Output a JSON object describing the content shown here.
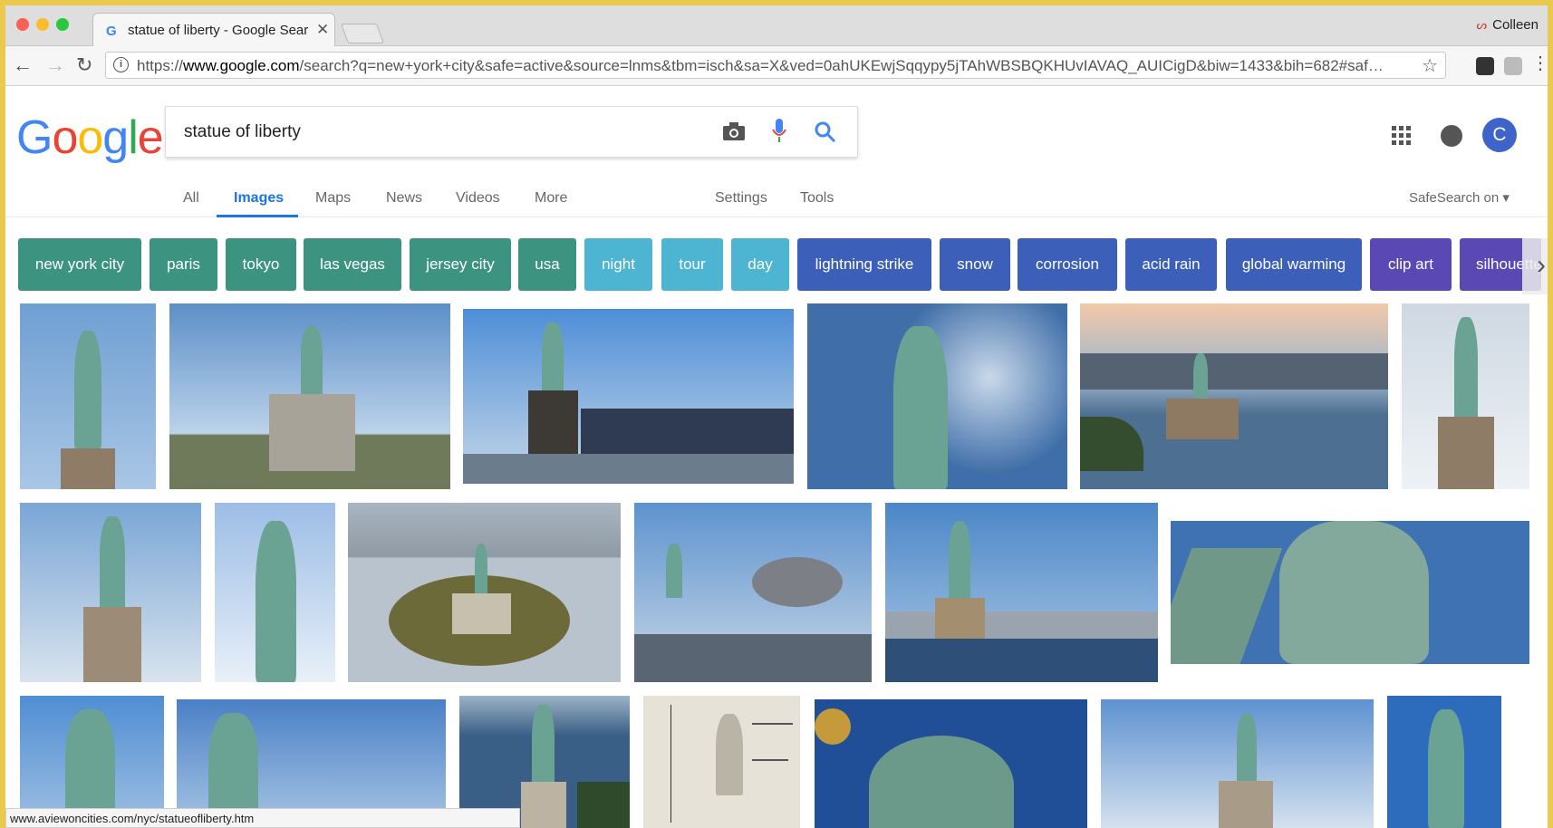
{
  "browser": {
    "tab_title": "statue of liberty - Google Sear",
    "tab_favicon": "G",
    "tab_close": "✕",
    "user_name": "Colleen",
    "url_prefix": "https://",
    "url_host": "www.google.com",
    "url_rest": "/search?q=new+york+city&safe=active&source=lnms&tbm=isch&sa=X&ved=0ahUKEwjSqqypy5jTAhWBSBQKHUvIAVAQ_AUICigD&biw=1433&bih=682#saf…",
    "status_url": "www.aviewoncities.com/nyc/statueofliberty.htm"
  },
  "search": {
    "logo": [
      "G",
      "o",
      "o",
      "g",
      "l",
      "e"
    ],
    "logo_colors": [
      "#4285f4",
      "#ea4335",
      "#fbbc05",
      "#4285f4",
      "#34a853",
      "#ea4335"
    ],
    "query": "statue of liberty"
  },
  "user": {
    "avatar_letter": "C"
  },
  "tabs": {
    "all": "All",
    "images": "Images",
    "maps": "Maps",
    "news": "News",
    "videos": "Videos",
    "more": "More",
    "settings": "Settings",
    "tools": "Tools",
    "safesearch": "SafeSearch on ▾"
  },
  "chips": [
    {
      "label": "new york city",
      "color": "#3c9380"
    },
    {
      "label": "paris",
      "color": "#3c9380"
    },
    {
      "label": "tokyo",
      "color": "#3c9380"
    },
    {
      "label": "las vegas",
      "color": "#3c9380"
    },
    {
      "label": "jersey city",
      "color": "#3c9380"
    },
    {
      "label": "usa",
      "color": "#3c9380"
    },
    {
      "label": "night",
      "color": "#4db5d1"
    },
    {
      "label": "tour",
      "color": "#4db5d1"
    },
    {
      "label": "day",
      "color": "#4db5d1"
    },
    {
      "label": "lightning strike",
      "color": "#3c5fb9"
    },
    {
      "label": "snow",
      "color": "#3c5fb9"
    },
    {
      "label": "corrosion",
      "color": "#3c5fb9"
    },
    {
      "label": "acid rain",
      "color": "#3c5fb9"
    },
    {
      "label": "global warming",
      "color": "#3c5fb9"
    },
    {
      "label": "clip art",
      "color": "#5a49b5"
    },
    {
      "label": "silhouette",
      "color": "#5a49b5"
    }
  ]
}
